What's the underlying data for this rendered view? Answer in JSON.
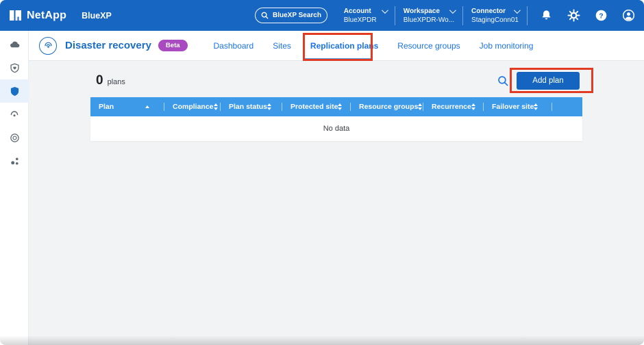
{
  "topbar": {
    "brand": "NetApp",
    "product": "BlueXP",
    "search_label": "BlueXP Search",
    "menus": [
      {
        "label": "Account",
        "value": "BlueXPDR"
      },
      {
        "label": "Workspace",
        "value": "BlueXPDR-Wo..."
      },
      {
        "label": "Connector",
        "value": "StagingConn01"
      }
    ],
    "icon_names": [
      "notifications-bell-icon",
      "settings-gear-icon",
      "help-icon",
      "user-profile-icon"
    ]
  },
  "sidebar": {
    "items": [
      {
        "icon": "storage-cloud-icon",
        "active": false
      },
      {
        "icon": "health-shield-icon",
        "active": false
      },
      {
        "icon": "protection-shield-icon",
        "active": true
      },
      {
        "icon": "restore-icon",
        "active": false
      },
      {
        "icon": "observability-icon",
        "active": false
      },
      {
        "icon": "mobility-nodes-icon",
        "active": false
      }
    ]
  },
  "page_header": {
    "title": "Disaster recovery",
    "badge": "Beta",
    "tabs": [
      {
        "label": "Dashboard",
        "active": false,
        "annotated": false
      },
      {
        "label": "Sites",
        "active": false,
        "annotated": false
      },
      {
        "label": "Replication plans",
        "active": true,
        "annotated": true
      },
      {
        "label": "Resource groups",
        "active": false,
        "annotated": false
      },
      {
        "label": "Job monitoring",
        "active": false,
        "annotated": false
      }
    ]
  },
  "content": {
    "plan_count": "0",
    "plan_count_label": "plans",
    "add_button_label": "Add plan",
    "table": {
      "columns": [
        {
          "label": "Plan",
          "sort": "asc"
        },
        {
          "label": "Compliance",
          "sort": "both"
        },
        {
          "label": "Plan status",
          "sort": "both"
        },
        {
          "label": "Protected site",
          "sort": "both"
        },
        {
          "label": "Resource groups",
          "sort": "both"
        },
        {
          "label": "Recurrence",
          "sort": "both"
        },
        {
          "label": "Failover site",
          "sort": "both"
        },
        {
          "label": "",
          "sort": "none"
        }
      ],
      "empty_text": "No data"
    }
  },
  "colors": {
    "topbar_blue": "#1766c2",
    "table_header_blue": "#3d9ae9",
    "button_blue": "#1565c0",
    "link_blue": "#1a73e8",
    "title_blue": "#1a6dc4",
    "beta_purple": "#a94ac0",
    "annotation_red": "#e23b24",
    "sidebar_selected_bg": "#e9f2fc",
    "content_bg": "#f1f3f5"
  }
}
